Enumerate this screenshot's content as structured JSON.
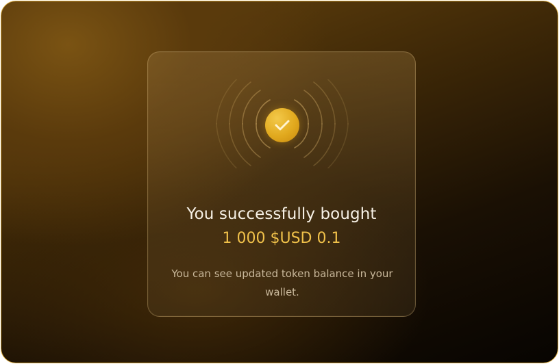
{
  "dialog": {
    "title": "You successfully bought",
    "amount": "1 000 $USD 0.1",
    "description": "You can see updated token balance in your wallet.",
    "icon": "check-circle-icon"
  },
  "colors": {
    "accent": "#f0c14a",
    "frame_border": "#d9a93a",
    "title_text": "#f7f1e6",
    "muted_text": "#c9b89b"
  }
}
